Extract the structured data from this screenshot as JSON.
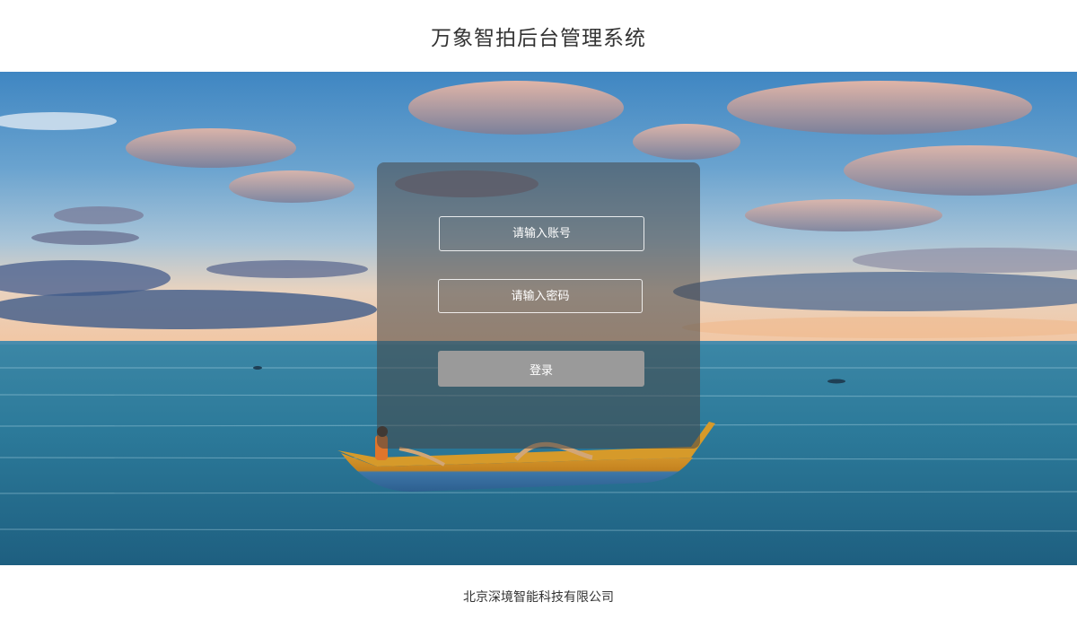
{
  "header": {
    "title": "万象智拍后台管理系统"
  },
  "login": {
    "account_placeholder": "请输入账号",
    "password_placeholder": "请输入密码",
    "submit_label": "登录"
  },
  "footer": {
    "company": "北京深境智能科技有限公司"
  },
  "colors": {
    "panel_bg": "rgba(70,70,70,0.55)",
    "button_bg": "#9a9a9a",
    "sea": "#2f7f9c",
    "sky": "#4a8cc4"
  }
}
